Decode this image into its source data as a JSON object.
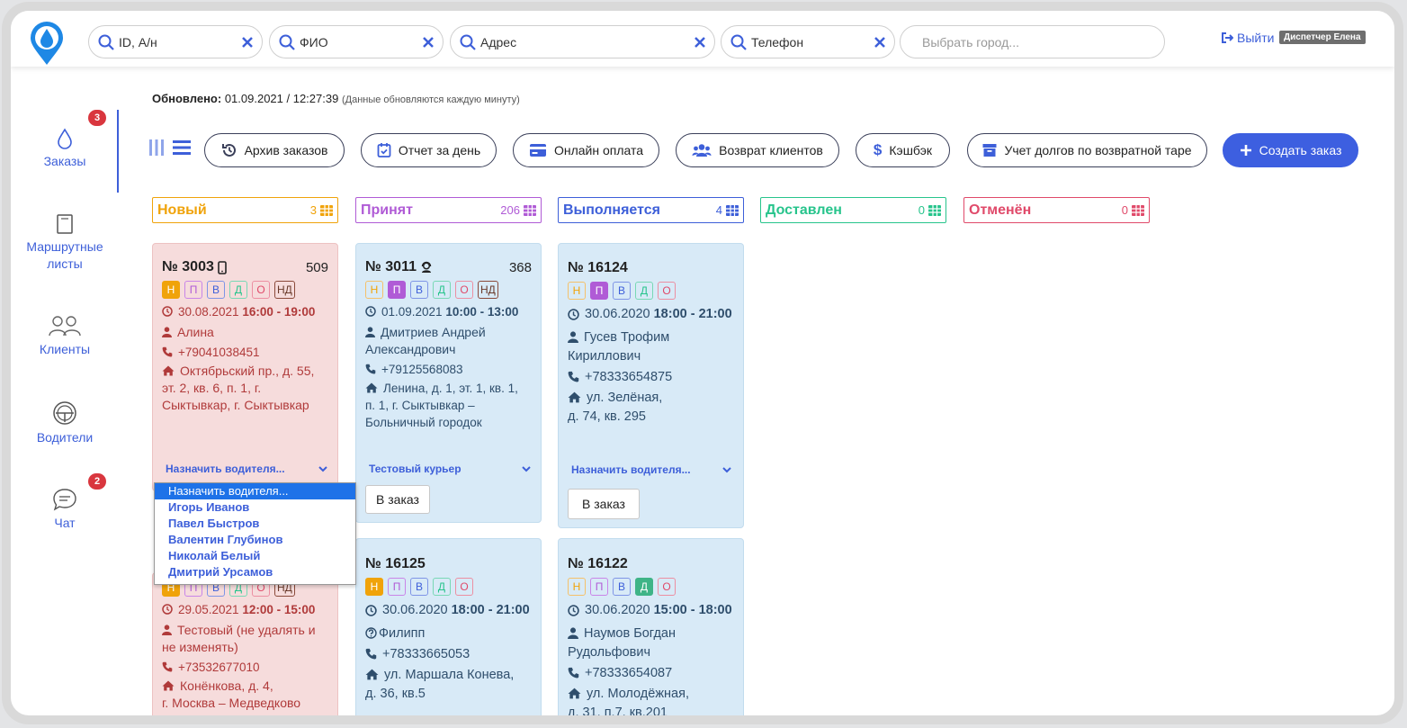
{
  "search": {
    "id_placeholder": "ID, А/н",
    "fio_placeholder": "ФИО",
    "address_placeholder": "Адрес",
    "phone_placeholder": "Телефон",
    "city_placeholder": "Выбрать город..."
  },
  "header": {
    "logout": "Выйти",
    "user": "Диспетчер Елена"
  },
  "sidebar": {
    "items": [
      {
        "label": "Заказы",
        "badge": "3"
      },
      {
        "label": "Маршрутные листы"
      },
      {
        "label": "Клиенты"
      },
      {
        "label": "Водители"
      },
      {
        "label": "Чат",
        "badge": "2"
      }
    ]
  },
  "status": {
    "updated_label": "Обновлено:",
    "updated_value": "01.09.2021 / 12:27:39",
    "note": "(Данные обновляются каждую минуту)"
  },
  "toolbar": {
    "archive": "Архив заказов",
    "day_report": "Отчет за день",
    "online_pay": "Онлайн оплата",
    "return_clients": "Возврат клиентов",
    "cashback": "Кэшбэк",
    "debts": "Учет долгов по возвратной таре",
    "create": "Создать заказ"
  },
  "columns": [
    {
      "title": "Новый",
      "count": "3",
      "color": "#f0a30a"
    },
    {
      "title": "Принят",
      "count": "206",
      "color": "#b05bd6"
    },
    {
      "title": "Выполняется",
      "count": "4",
      "color": "#3d5fd9"
    },
    {
      "title": "Доставлен",
      "count": "0",
      "color": "#27c48c"
    },
    {
      "title": "Отменён",
      "count": "0",
      "color": "#e04a6a"
    }
  ],
  "chips": {
    "n": "Н",
    "p": "П",
    "v": "В",
    "d": "Д",
    "o": "О",
    "nd": "НД"
  },
  "cards": {
    "c3003": {
      "number": "№ 3003",
      "amount": "509",
      "date": "30.08.2021",
      "time": "16:00 - 19:00",
      "name": "Алина",
      "phone": "+79041038451",
      "address_1": "Октябрьский пр., д. 55,",
      "address_2": "эт. 2, кв. 6, п. 1, г.",
      "address_3": "Сыктывкар, г. Сыктывкар",
      "assign": "Назначить водителя..."
    },
    "c3011": {
      "number": "№ 3011",
      "amount": "368",
      "date": "01.09.2021",
      "time": "10:00 - 13:00",
      "name_1": "Дмитриев Андрей",
      "name_2": "Александрович",
      "phone": "+79125568083",
      "address_1": "Ленина, д. 1, эт. 1, кв. 1,",
      "address_2": "п. 1, г. Сыктывкар –",
      "address_3": "Больничный городок",
      "courier": "Тестовый курьер",
      "to_order": "В заказ"
    },
    "c16124": {
      "number": "№ 16124",
      "date": "30.06.2020",
      "time": "18:00 - 21:00",
      "name_1": "Гусев Трофим",
      "name_2": "Кириллович",
      "phone": "+78333654875",
      "address_1": "ул. Зелёная,",
      "address_2": "д. 74, кв. 295",
      "assign": "Назначить водителя...",
      "to_order": "В заказ"
    },
    "c_pink2": {
      "date": "29.05.2021",
      "time": "12:00 - 15:00",
      "name_1": "Тестовый (не удалять и",
      "name_2": "не изменять)",
      "phone": "+73532677010",
      "address_1": "Конёнкова, д. 4,",
      "address_2": "г. Москва – Медведково"
    },
    "c16125": {
      "number": "№ 16125",
      "date": "30.06.2020",
      "time": "18:00 - 21:00",
      "name": "Филипп",
      "phone": "+78333665053",
      "address_1": "ул. Маршала Конева,",
      "address_2": "д. 36, кв.5"
    },
    "c16122": {
      "number": "№ 16122",
      "date": "30.06.2020",
      "time": "15:00 - 18:00",
      "name_1": "Наумов Богдан",
      "name_2": "Рудольфович",
      "phone": "+78333654087",
      "address_1": "ул. Молодёжная,",
      "address_2": "д. 31, п.7, кв.201"
    }
  },
  "dropdown": {
    "items": [
      "Назначить водителя...",
      "Игорь Иванов",
      "Павел Быстров",
      "Валентин Глубинов",
      "Николай Белый",
      "Дмитрий Урсамов"
    ]
  },
  "colors": {
    "accent": "#3d5fd9",
    "create": "#3d5fe0",
    "badge": "#d9363e"
  }
}
